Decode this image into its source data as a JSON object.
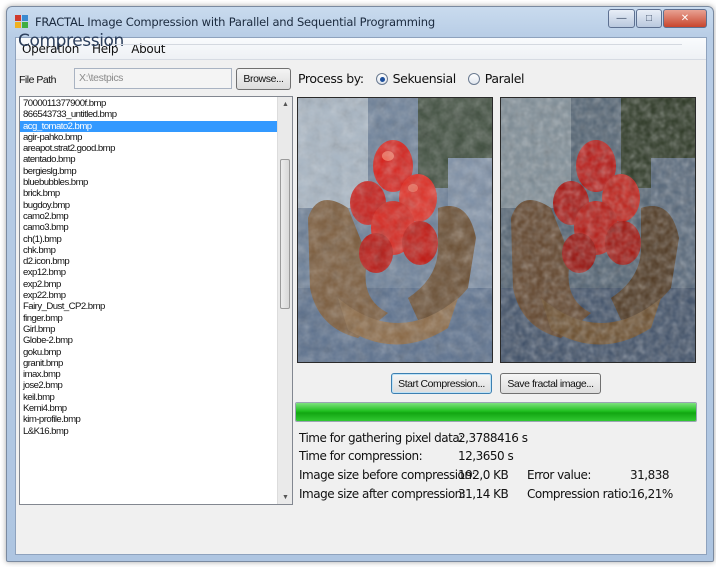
{
  "window": {
    "title": "FRACTAL Image Compression with Parallel and Sequential Programming",
    "controls": {
      "minimize": "—",
      "maximize": "□",
      "close": "✕"
    }
  },
  "menu": [
    "Operation",
    "Help",
    "About"
  ],
  "group_title": "Compression",
  "file_path": {
    "label": "File Path",
    "value": "X:\\testpics",
    "browse_label": "Browse..."
  },
  "process_by": {
    "label": "Process by:",
    "options": [
      {
        "label": "Sekuensial",
        "checked": true
      },
      {
        "label": "Paralel",
        "checked": false
      }
    ]
  },
  "file_list": {
    "selected_index": 2,
    "items": [
      "7000011377900f.bmp",
      "866543733_untitled.bmp",
      "acg_tomato2.bmp",
      "agir-pahko.bmp",
      "areapot.strat2.good.bmp",
      "atentado.bmp",
      "bergieslg.bmp",
      "bluebubbles.bmp",
      "brick.bmp",
      "bugdoy.bmp",
      "camo2.bmp",
      "camo3.bmp",
      "ch(1).bmp",
      "chk.bmp",
      "d2.icon.bmp",
      "exp12.bmp",
      "exp2.bmp",
      "exp22.bmp",
      "Fairy_Dust_CP2.bmp",
      "finger.bmp",
      "Girl.bmp",
      "Globe-2.bmp",
      "goku.bmp",
      "granit.bmp",
      "imax.bmp",
      "jose2.bmp",
      "keil.bmp",
      "Kemi4.bmp",
      "kim-profile.bmp",
      "L&K16.bmp"
    ]
  },
  "buttons": {
    "start": "Start Compression...",
    "save": "Save fractal image..."
  },
  "progress": {
    "fraction": 1.0,
    "color": "#1fbf1f"
  },
  "stats": {
    "gather_label": "Time for gathering pixel data:",
    "gather_value": "2,3788416 s",
    "compress_label": "Time for compression:",
    "compress_value": "12,3650 s",
    "size_before_label": "Image size before compression:",
    "size_before_value": "192,0 KB",
    "size_after_label": "Image size after compression:",
    "size_after_value": "31,14 KB",
    "error_label": "Error value:",
    "error_value": "31,838",
    "ratio_label": "Compression ratio:",
    "ratio_value": "16,21%"
  },
  "colors": {
    "selection": "#3399ff",
    "title_text": "#2c3f5c"
  }
}
